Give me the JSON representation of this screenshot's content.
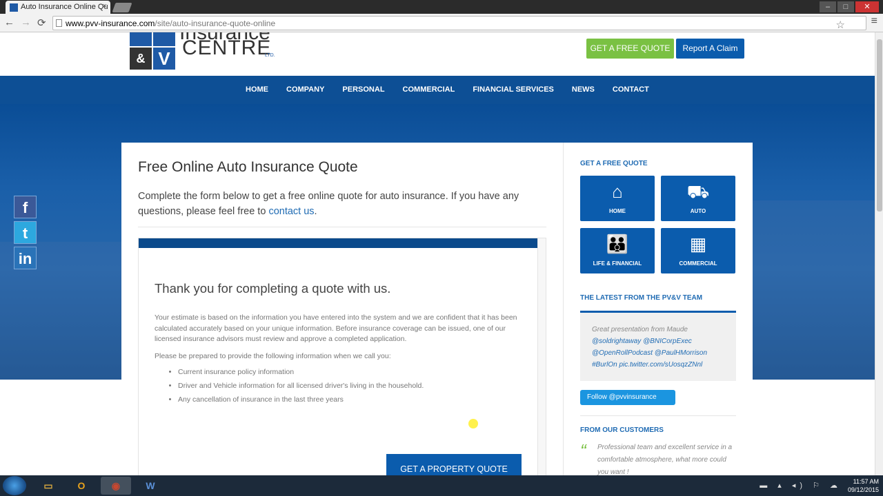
{
  "browser": {
    "tab_title": "Auto Insurance Online Qu",
    "tab_close": "×",
    "url_host": "www.pvv-insurance.com",
    "url_path": "/site/auto-insurance-quote-online",
    "back": "←",
    "forward": "→",
    "reload": "⟳",
    "star": "☆",
    "menu": "≡",
    "win_min": "–",
    "win_max": "□",
    "win_close": "✕"
  },
  "header": {
    "logo_top": "Insurance",
    "logo_bottom": "CENTRE",
    "logo_ltd": "LTD.",
    "logo_amp": "&",
    "logo_v": "V",
    "quote_button": "GET A FREE QUOTE",
    "claim_button": "Report A Claim"
  },
  "nav": [
    "HOME",
    "COMPANY",
    "PERSONAL",
    "COMMERCIAL",
    "FINANCIAL SERVICES",
    "NEWS",
    "CONTACT"
  ],
  "social": {
    "facebook": "f",
    "twitter": "t",
    "linkedin": "in"
  },
  "main": {
    "title": "Free Online Auto Insurance Quote",
    "intro": "Complete the form below to get a free online quote for auto insurance. If you have any questions, please feel free to ",
    "intro_link": "contact us",
    "intro_end": ".",
    "thanks_heading": "Thank you for completing a quote with us.",
    "para1": "Your estimate is based on the information you have entered into the system and we are confident that it has been calculated accurately based on your unique information. Before insurance coverage can be issued, one of our licensed insurance advisors must review and approve a completed application.",
    "para2": "Please be prepared to provide the following information when we call you:",
    "list": [
      "Current insurance policy information",
      "Driver and Vehicle information for all licensed driver's living in the household.",
      "Any cancellation of insurance in the last three years"
    ],
    "property_button": "GET A PROPERTY QUOTE"
  },
  "sidebar": {
    "quote_heading": "GET A FREE QUOTE",
    "tiles": [
      {
        "label": "HOME",
        "icon": "house-icon",
        "glyph": "⌂"
      },
      {
        "label": "AUTO",
        "icon": "car-icon",
        "glyph": "⛟"
      },
      {
        "label": "LIFE & FINANCIAL",
        "icon": "family-icon",
        "glyph": "👪"
      },
      {
        "label": "COMMERCIAL",
        "icon": "building-icon",
        "glyph": "▦"
      }
    ],
    "latest_heading": "THE LATEST FROM THE PV&V TEAM",
    "tweet_text": "Great presentation from Maude",
    "tweet_links": "@soldrightaway @BNICorpExec @OpenRollPodcast @PaulHMorrison #BurlOn pic.twitter.com/sUosqzZNnl",
    "follow": "Follow @pvvinsurance",
    "customers_heading": "FROM OUR CUSTOMERS",
    "testimonial": "Professional team and excellent service in a comfortable atmosphere, what more could you want !"
  },
  "taskbar": {
    "apps": [
      {
        "name": "explorer",
        "glyph": "▭",
        "color": "#d9a93f"
      },
      {
        "name": "outlook",
        "glyph": "O",
        "color": "#e8a21c"
      },
      {
        "name": "chrome",
        "glyph": "◉",
        "color": "#c9472f"
      },
      {
        "name": "word",
        "glyph": "W",
        "color": "#2b579a"
      }
    ],
    "tray": "▬ ▴ ◂) ⚐ ☁",
    "time": "11:57 AM",
    "date": "09/12/2015"
  }
}
